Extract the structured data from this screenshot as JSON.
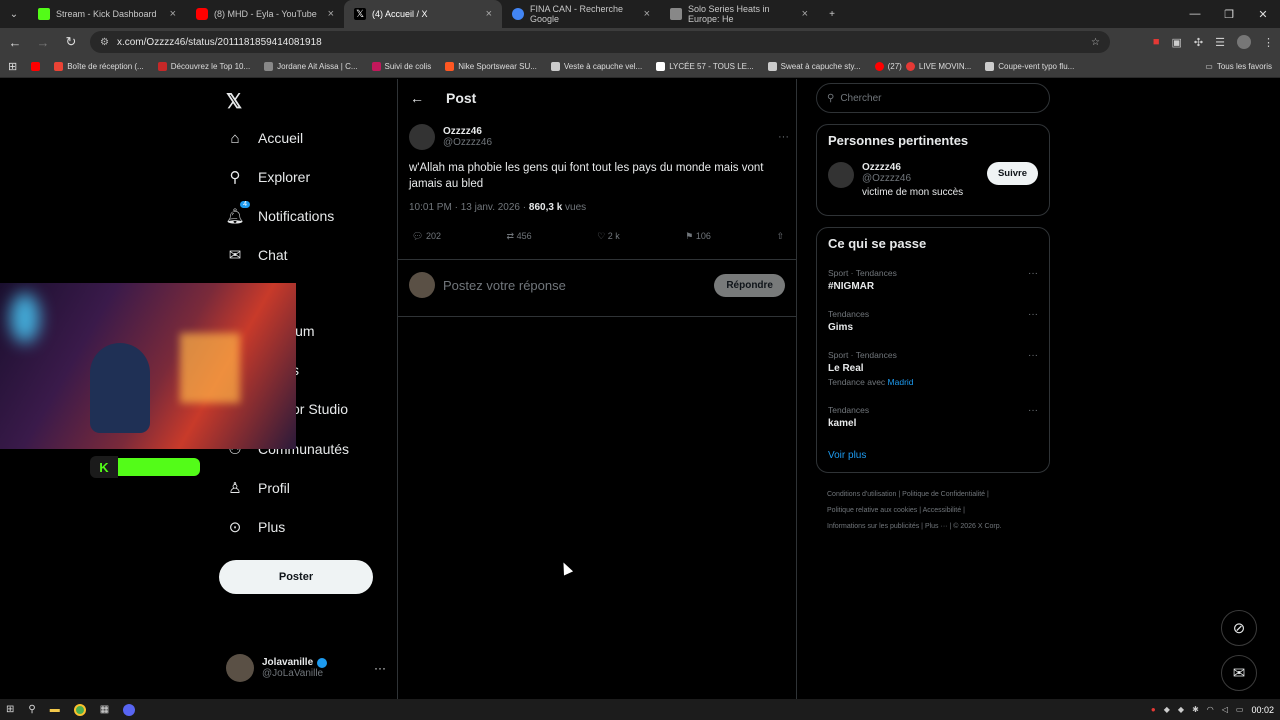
{
  "browser": {
    "tabs": [
      {
        "title": "Stream - Kick Dashboard",
        "color": "#53fc18"
      },
      {
        "title": "(8) MHD - Eyla - YouTube",
        "color": "#ff0000"
      },
      {
        "title": "(4) Accueil / X",
        "color": "#ffffff"
      },
      {
        "title": "FINA CAN - Recherche Google",
        "color": "#4285f4"
      },
      {
        "title": "Solo Series Heats in Europe: He",
        "color": "#888888"
      }
    ],
    "url": "x.com/Ozzzz46/status/2011181859414081918",
    "bookmarks": [
      "Boîte de réception (...",
      "Découvrez le Top 10...",
      "Jordane Ait Aissa | C...",
      "Suivi de colis",
      "Nike Sportswear SU...",
      "Veste à capuche vel...",
      "LYCÉE 57 - TOUS LE...",
      "Sweat à capuche sty...",
      "(27)",
      "LIVE MOVIN...",
      "Coupe-vent typo flu..."
    ],
    "all_bookmarks": "Tous les favoris"
  },
  "nav": {
    "items": [
      {
        "label": "Accueil",
        "icon": "home-icon"
      },
      {
        "label": "Explorer",
        "icon": "search-icon"
      },
      {
        "label": "Notifications",
        "icon": "bell-icon",
        "badge": "4"
      },
      {
        "label": "Chat",
        "icon": "mail-icon"
      },
      {
        "label": "ium",
        "icon": "premium-icon"
      },
      {
        "label": "s",
        "icon": "lists-icon"
      },
      {
        "label": "or Studio",
        "icon": "studio-icon"
      },
      {
        "label": "Communautés",
        "icon": "communities-icon"
      },
      {
        "label": "Profil",
        "icon": "user-icon"
      },
      {
        "label": "Plus",
        "icon": "more-icon"
      }
    ],
    "post_button": "Poster",
    "account": {
      "name": "Jolavanille",
      "handle": "@JoLaVanille"
    }
  },
  "post": {
    "header": "Post",
    "author_name": "Ozzzz46",
    "author_handle": "@Ozzzz46",
    "text": "w'Allah ma phobie les gens qui font tout les pays du monde mais vont jamais au bled",
    "time": "10:01 PM · 13 janv. 2026 · ",
    "views_count": "860,3 k",
    "views_label": " vues",
    "replies": "202",
    "reposts": "456",
    "likes": "2 k",
    "bookmarks": "106",
    "reply_placeholder": "Postez votre réponse",
    "reply_button": "Répondre"
  },
  "sidebar": {
    "search_placeholder": "Chercher",
    "relevant_title": "Personnes pertinentes",
    "relevant_person": {
      "name": "Ozzzz46",
      "handle": "@Ozzzz46",
      "bio": "victime de mon succès",
      "follow": "Suivre"
    },
    "trends_title": "Ce qui se passe",
    "trends": [
      {
        "context": "Sport · Tendances",
        "name": "#NIGMAR",
        "extra": ""
      },
      {
        "context": "Tendances",
        "name": "Gims",
        "extra": ""
      },
      {
        "context": "Sport · Tendances",
        "name": "Le Real",
        "extra_prefix": "Tendance avec ",
        "extra": "Madrid"
      },
      {
        "context": "Tendances",
        "name": "kamel",
        "extra": ""
      }
    ],
    "see_more": "Voir plus",
    "footer": [
      "Conditions d'utilisation",
      "Politique de Confidentialité",
      "Politique relative aux cookies",
      "Accessibilité",
      "Informations sur les publicités",
      "Plus ···",
      "© 2026 X Corp."
    ]
  },
  "taskbar": {
    "clock": "00:02"
  }
}
